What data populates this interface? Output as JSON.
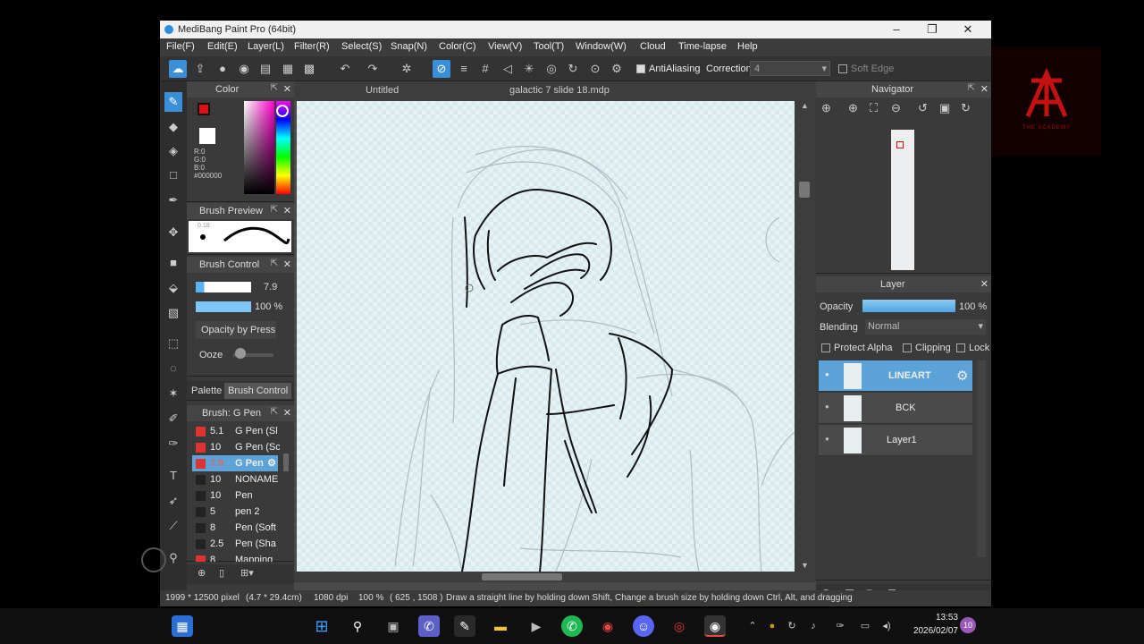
{
  "window": {
    "title": "MediBang Paint Pro (64bit)"
  },
  "menu": [
    "File(F)",
    "Edit(E)",
    "Layer(L)",
    "Filter(R)",
    "Select(S)",
    "Snap(N)",
    "Color(C)",
    "View(V)",
    "Tool(T)",
    "Window(W)",
    "Cloud",
    "Time-lapse",
    "Help"
  ],
  "toolbar": {
    "antialiasing": "AntiAliasing",
    "correction_label": "Correction",
    "correction_value": "4",
    "soft_edge": "Soft Edge"
  },
  "color_panel": {
    "title": "Color",
    "r": "R:0",
    "g": "G:0",
    "b": "B:0",
    "hex": "#000000",
    "primary": "#e01010",
    "secondary": "#ffffff"
  },
  "brush_preview": {
    "title": "Brush Preview",
    "size": "0.18"
  },
  "brush_control": {
    "title": "Brush Control",
    "size": "7.9",
    "opacity": "100 %",
    "opacity_by_pressure": "Opacity by Press",
    "ooze": "Ooze"
  },
  "palette_tabs": {
    "palette": "Palette",
    "brush_control": "Brush Control"
  },
  "brush_list": {
    "title": "Brush: G Pen",
    "items": [
      {
        "size": "5.1",
        "name": "G Pen (Sl"
      },
      {
        "size": "10",
        "name": "G Pen (Sc"
      },
      {
        "size": "7.9",
        "name": "G Pen"
      },
      {
        "size": "10",
        "name": "NONAME"
      },
      {
        "size": "10",
        "name": "Pen"
      },
      {
        "size": "5",
        "name": "pen 2"
      },
      {
        "size": "8",
        "name": "Pen (Soft"
      },
      {
        "size": "2.5",
        "name": "Pen (Sha"
      },
      {
        "size": "8",
        "name": "Mapping"
      }
    ]
  },
  "canvas": {
    "tab1": "Untitled",
    "tab2": "galactic 7 slide 18.mdp"
  },
  "navigator": {
    "title": "Navigator"
  },
  "layer_panel": {
    "title": "Layer",
    "opacity_label": "Opacity",
    "opacity_value": "100 %",
    "blending_label": "Blending",
    "blending_value": "Normal",
    "protect_alpha": "Protect Alpha",
    "clipping": "Clipping",
    "lock": "Lock",
    "layers": [
      {
        "name": "LINEART"
      },
      {
        "name": "BCK"
      },
      {
        "name": "Layer1"
      }
    ]
  },
  "status": {
    "dimensions": "1999 * 12500 pixel",
    "physical": "(4.7 * 29.4cm)",
    "dpi": "1080 dpi",
    "zoom": "100 %",
    "cursor": "( 625 , 1508 )",
    "hint": "Draw a straight line by holding down Shift, Change a brush size by holding down Ctrl, Alt, and dragging"
  },
  "taskbar": {
    "time": "13:53",
    "date": "2026/02/07",
    "badge": "10"
  },
  "watermark": {
    "text": "THE ACADEMY"
  },
  "colors": {
    "accent": "#3a8fd8",
    "panel": "#3a3a3a",
    "selected_layer": "#5ba3d9"
  }
}
